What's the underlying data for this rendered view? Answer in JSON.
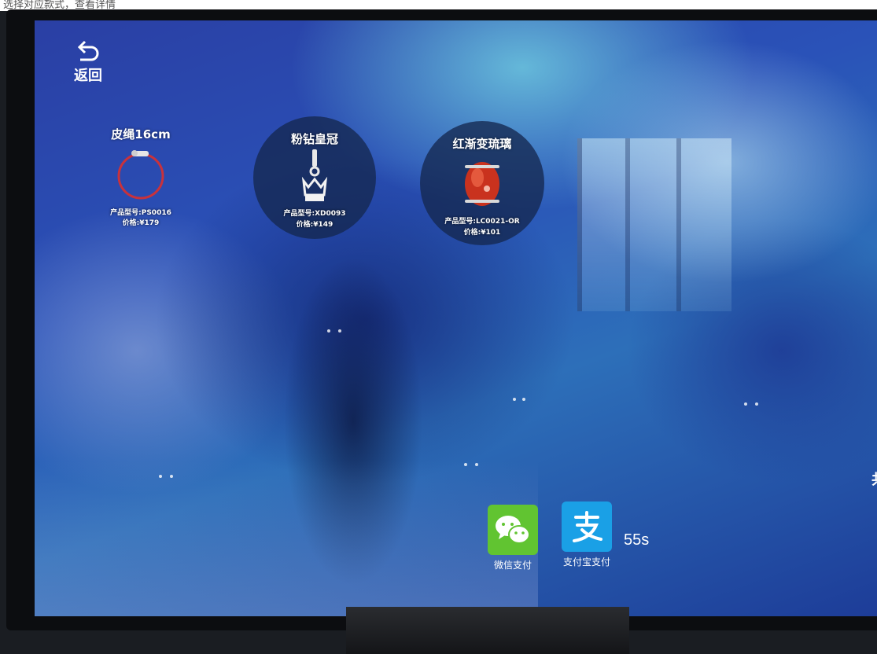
{
  "caption": "选择对应款式，查看详情",
  "back": {
    "label": "返回"
  },
  "products": [
    {
      "name": "皮绳16cm",
      "model": "产品型号:PS0016",
      "price": "价格:¥179"
    },
    {
      "name": "粉钻皇冠",
      "model": "产品型号:XD0093",
      "price": "价格:¥149"
    },
    {
      "name": "红渐变琉璃",
      "model": "产品型号:LC0021-OR",
      "price": "价格:¥101"
    }
  ],
  "payment": {
    "wechat_label": "微信支付",
    "alipay_label": "支付宝支付",
    "countdown": "55s",
    "partial_text": "共"
  },
  "colors": {
    "wechat": "#61c431",
    "alipay": "#1aa0e6",
    "bracelet": "#c8323c"
  },
  "icons": {
    "back": "back-arrow-icon",
    "wechat": "wechat-icon",
    "alipay": "alipay-icon"
  }
}
